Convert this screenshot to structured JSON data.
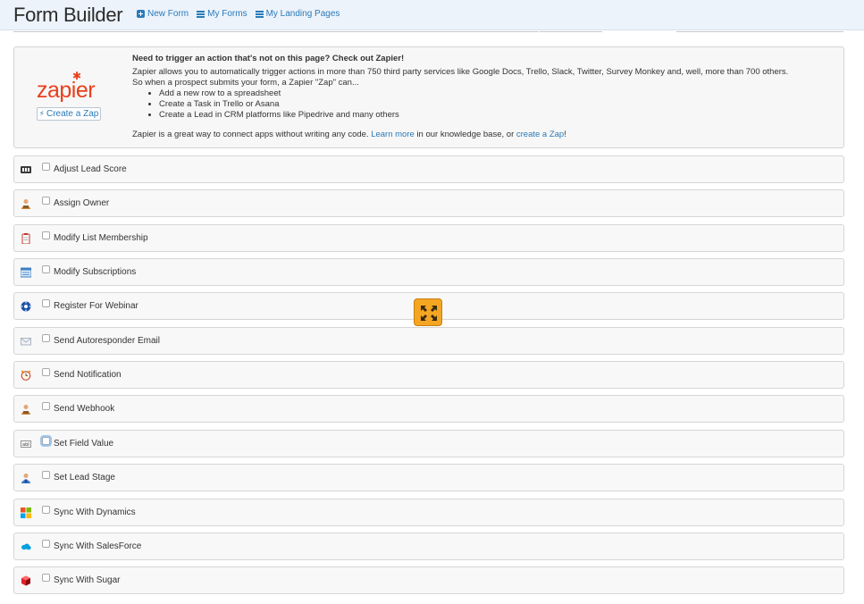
{
  "app": {
    "title": "Form Builder"
  },
  "nav": {
    "new_form": "New Form",
    "my_forms": "My Forms",
    "my_landing_pages": "My Landing Pages"
  },
  "zapier": {
    "logo_text": "zapier",
    "create_button": "Create a Zap",
    "heading": "Need to trigger an action that's not on this page? Check out Zapier!",
    "intro_line1": "Zapier allows you to automatically trigger actions in more than 750 third party services like Google Docs, Trello, Slack, Twitter, Survey Monkey and, well, more than 700 others.",
    "intro_line2": "So when a prospect submits your form, a Zapier \"Zap\" can...",
    "bullets": [
      "Add a new row to a spreadsheet",
      "Create a Task in Trello or Asana",
      "Create a Lead in CRM platforms like Pipedrive and many others"
    ],
    "footer_pre": "Zapier is a great way to connect apps without writing any code.",
    "footer_learn_more": "Learn more",
    "footer_mid": "in our knowledge base, or",
    "footer_create": "create a Zap",
    "footer_end": "!"
  },
  "actions": [
    {
      "label": "Adjust Lead Score",
      "icon": "score-icon"
    },
    {
      "label": "Assign Owner",
      "icon": "owner-icon"
    },
    {
      "label": "Modify List Membership",
      "icon": "clipboard-icon"
    },
    {
      "label": "Modify Subscriptions",
      "icon": "subscriptions-icon"
    },
    {
      "label": "Register For Webinar",
      "icon": "webinar-icon"
    },
    {
      "label": "Send Autoresponder Email",
      "icon": "envelope-icon"
    },
    {
      "label": "Send Notification",
      "icon": "alarm-clock-icon"
    },
    {
      "label": "Send Webhook",
      "icon": "webhook-icon"
    },
    {
      "label": "Set Field Value",
      "icon": "text-field-icon"
    },
    {
      "label": "Set Lead Stage",
      "icon": "lead-stage-icon"
    },
    {
      "label": "Sync With Dynamics",
      "icon": "microsoft-icon"
    },
    {
      "label": "Sync With SalesForce",
      "icon": "salesforce-icon"
    },
    {
      "label": "Sync With Sugar",
      "icon": "sugar-icon"
    }
  ],
  "colors": {
    "accent": "#2a7ab8",
    "zapier_orange": "#e8401c",
    "expand_button": "#f4a623"
  }
}
